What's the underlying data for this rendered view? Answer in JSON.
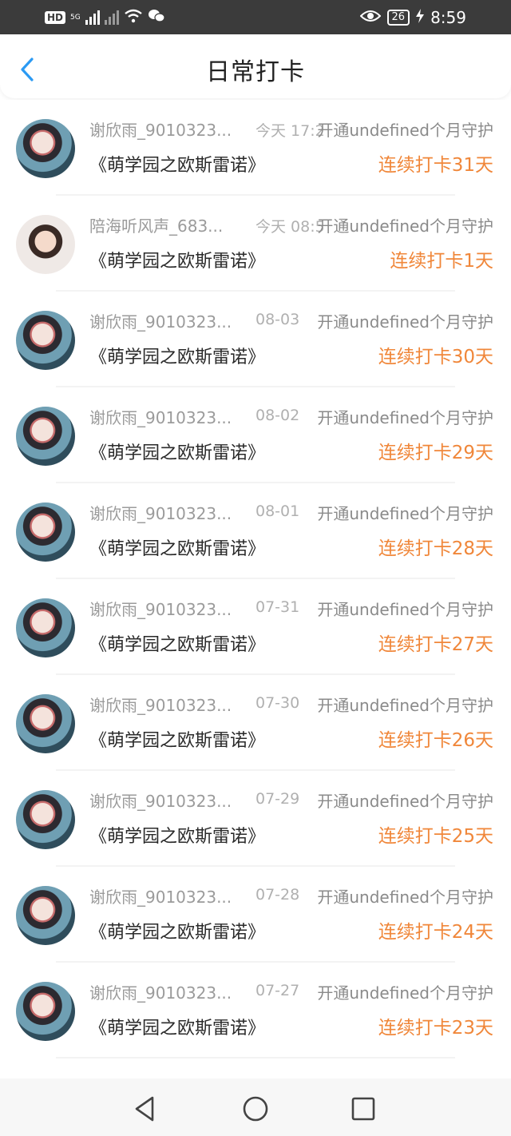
{
  "status_bar": {
    "time": "8:59",
    "battery": "26",
    "network": "5G",
    "icons": [
      "hd-icon",
      "signal-icon",
      "signal-icon",
      "wifi-icon",
      "wechat-icon",
      "eye-icon",
      "battery-icon",
      "charging-icon"
    ]
  },
  "header": {
    "title": "日常打卡",
    "back_icon": "chevron-left-icon"
  },
  "colors": {
    "accent_orange": "#f0873a",
    "back_blue": "#2b9af3",
    "status_bar_bg": "#3b3b3b"
  },
  "list": [
    {
      "name": "谢欣雨_9010323...",
      "time": "今天 17:2",
      "open_text": "开通undefined个月守护",
      "book": "《萌学园之欧斯雷诺》",
      "streak": "连续打卡31天",
      "avatar": "avatar-man"
    },
    {
      "name": "陪海听风声_683...",
      "time": "今天 08:5",
      "open_text": "开通undefined个月守护",
      "book": "《萌学园之欧斯雷诺》",
      "streak": "连续打卡1天",
      "avatar": "avatar-girl"
    },
    {
      "name": "谢欣雨_9010323...",
      "time": "08-03",
      "open_text": "开通undefined个月守护",
      "book": "《萌学园之欧斯雷诺》",
      "streak": "连续打卡30天",
      "avatar": "avatar-man"
    },
    {
      "name": "谢欣雨_9010323...",
      "time": "08-02",
      "open_text": "开通undefined个月守护",
      "book": "《萌学园之欧斯雷诺》",
      "streak": "连续打卡29天",
      "avatar": "avatar-man"
    },
    {
      "name": "谢欣雨_9010323...",
      "time": "08-01",
      "open_text": "开通undefined个月守护",
      "book": "《萌学园之欧斯雷诺》",
      "streak": "连续打卡28天",
      "avatar": "avatar-man"
    },
    {
      "name": "谢欣雨_9010323...",
      "time": "07-31",
      "open_text": "开通undefined个月守护",
      "book": "《萌学园之欧斯雷诺》",
      "streak": "连续打卡27天",
      "avatar": "avatar-man"
    },
    {
      "name": "谢欣雨_9010323...",
      "time": "07-30",
      "open_text": "开通undefined个月守护",
      "book": "《萌学园之欧斯雷诺》",
      "streak": "连续打卡26天",
      "avatar": "avatar-man"
    },
    {
      "name": "谢欣雨_9010323...",
      "time": "07-29",
      "open_text": "开通undefined个月守护",
      "book": "《萌学园之欧斯雷诺》",
      "streak": "连续打卡25天",
      "avatar": "avatar-man"
    },
    {
      "name": "谢欣雨_9010323...",
      "time": "07-28",
      "open_text": "开通undefined个月守护",
      "book": "《萌学园之欧斯雷诺》",
      "streak": "连续打卡24天",
      "avatar": "avatar-man"
    },
    {
      "name": "谢欣雨_9010323...",
      "time": "07-27",
      "open_text": "开通undefined个月守护",
      "book": "《萌学园之欧斯雷诺》",
      "streak": "连续打卡23天",
      "avatar": "avatar-man"
    }
  ],
  "nav_bar": {
    "icons": [
      "back-triangle-icon",
      "home-circle-icon",
      "recents-square-icon"
    ]
  }
}
